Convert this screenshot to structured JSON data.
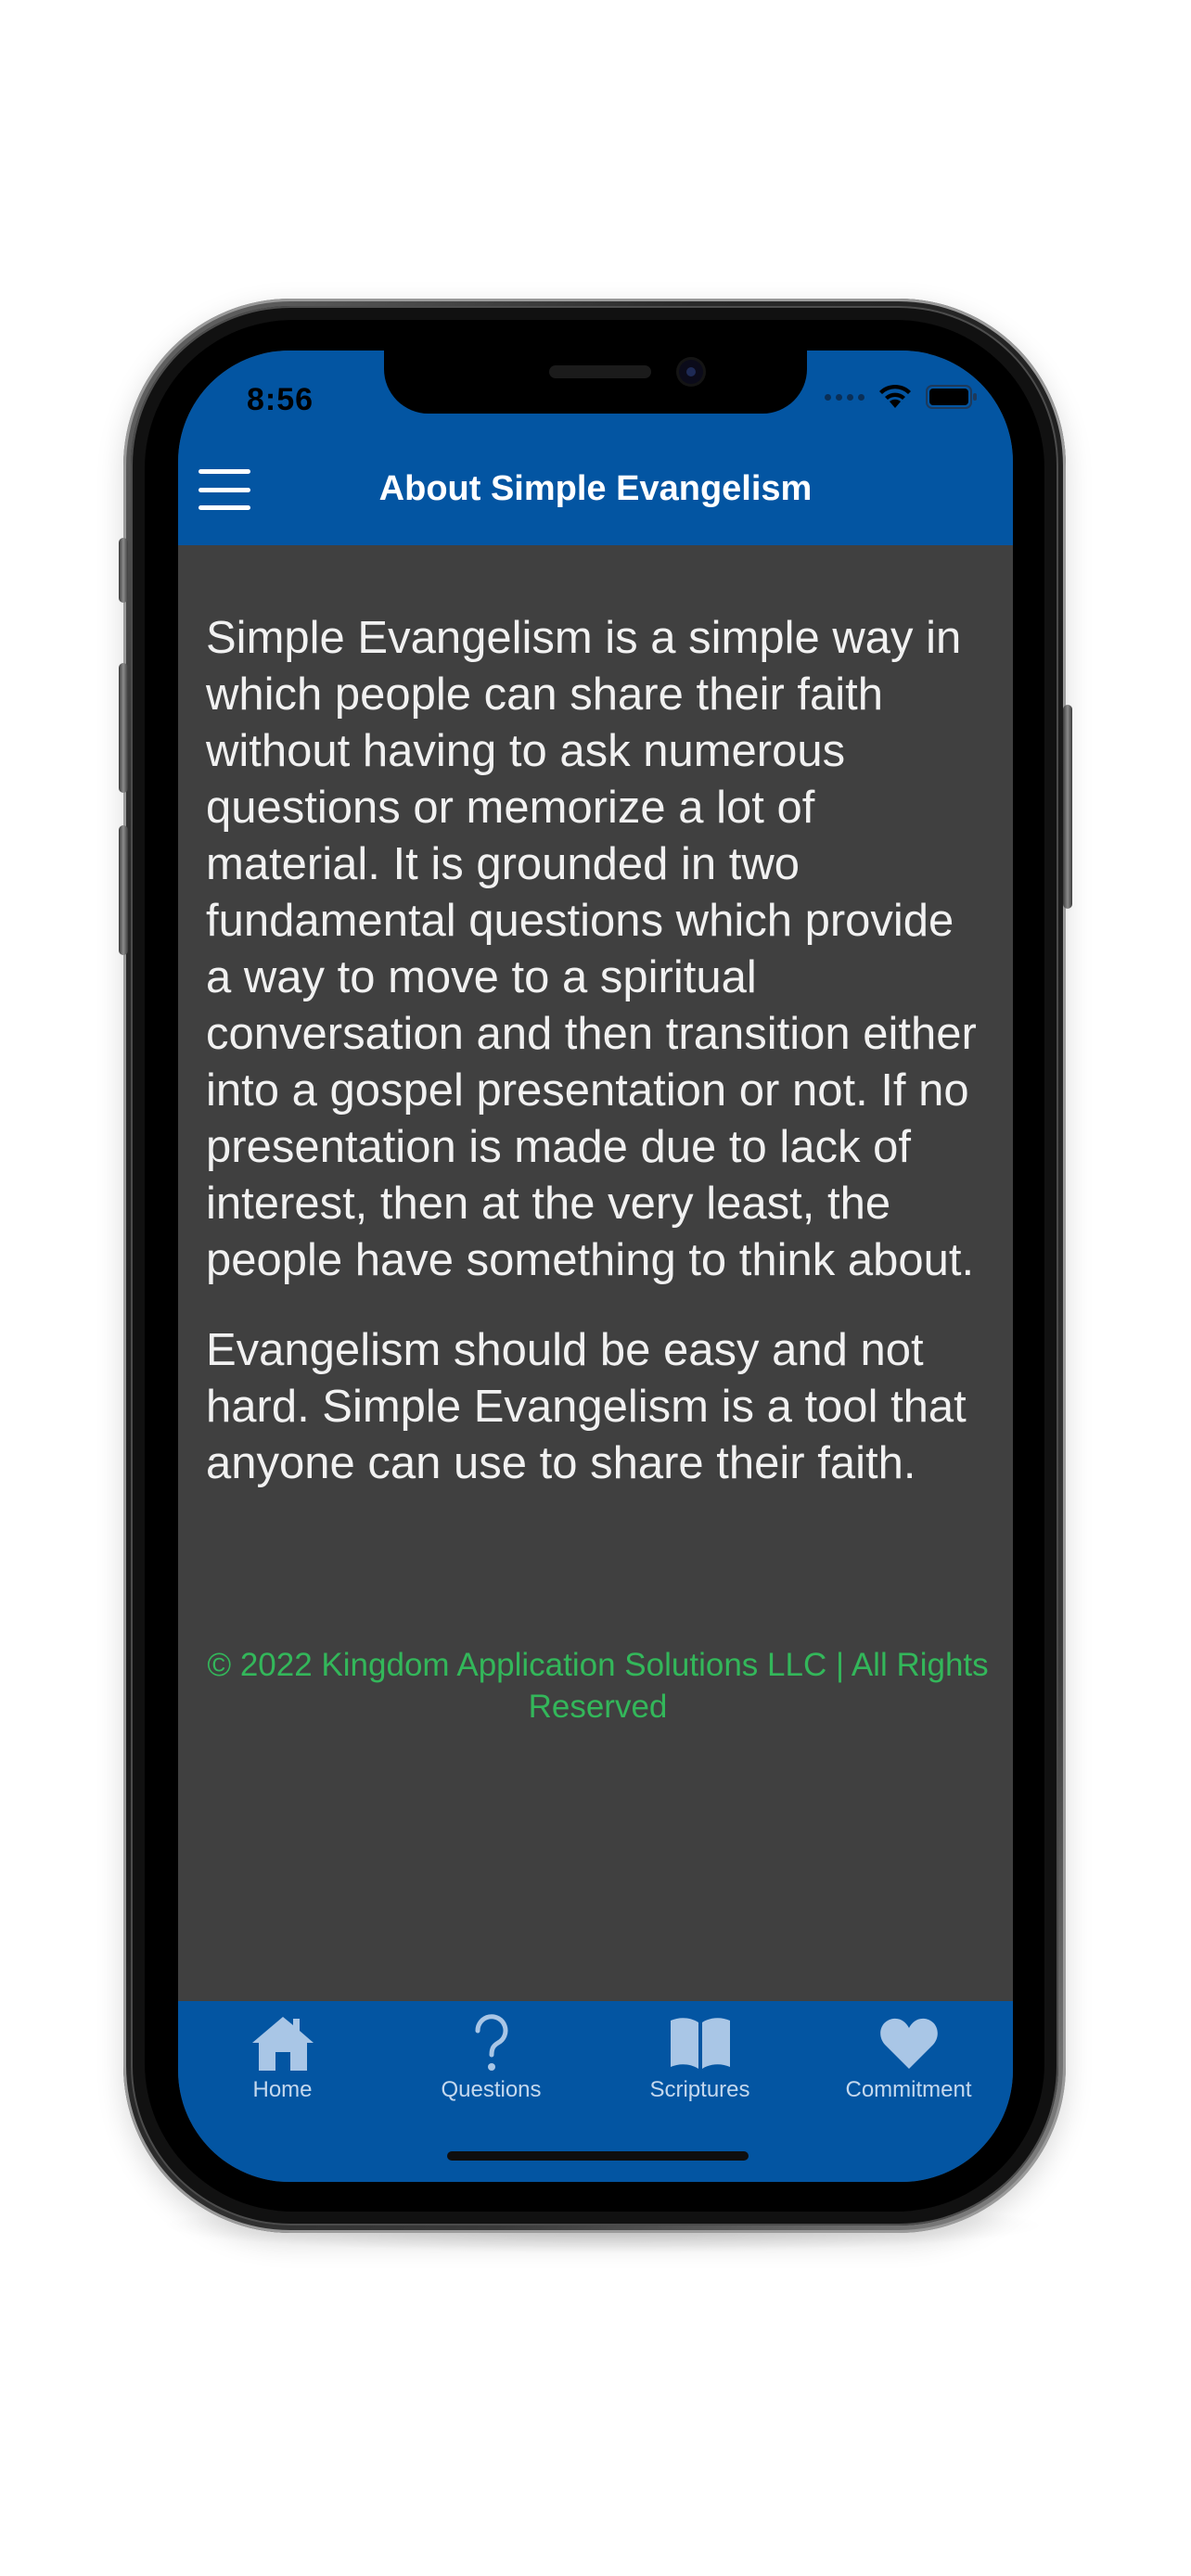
{
  "status_bar": {
    "time": "8:56"
  },
  "header": {
    "title": "About Simple Evangelism"
  },
  "content": {
    "paragraphs": [
      "Simple Evangelism is a simple way in which people can share their faith without having to ask numerous questions or memorize a lot of material. It is grounded in two fundamental questions which provide a way to move to a spiritual conversation and then transition either into a gospel presentation or not. If no presentation is made due to lack of interest, then at the very least, the people have something to think about.",
      "Evangelism should be easy and not hard. Simple Evangelism is a tool that anyone can use to share their faith."
    ],
    "copyright": "© 2022 Kingdom Application Solutions LLC | All Rights Reserved"
  },
  "tabbar": {
    "tabs": [
      {
        "label": "Home",
        "icon": "home-icon"
      },
      {
        "label": "Questions",
        "icon": "question-mark-icon"
      },
      {
        "label": "Scriptures",
        "icon": "book-icon"
      },
      {
        "label": "Commitment",
        "icon": "heart-icon"
      }
    ]
  },
  "colors": {
    "brand_blue": "#0355a2",
    "content_bg": "#404040",
    "body_text": "#f1f1f1",
    "copyright_green": "#33b75a",
    "tab_icon": "#a9c6e6"
  }
}
